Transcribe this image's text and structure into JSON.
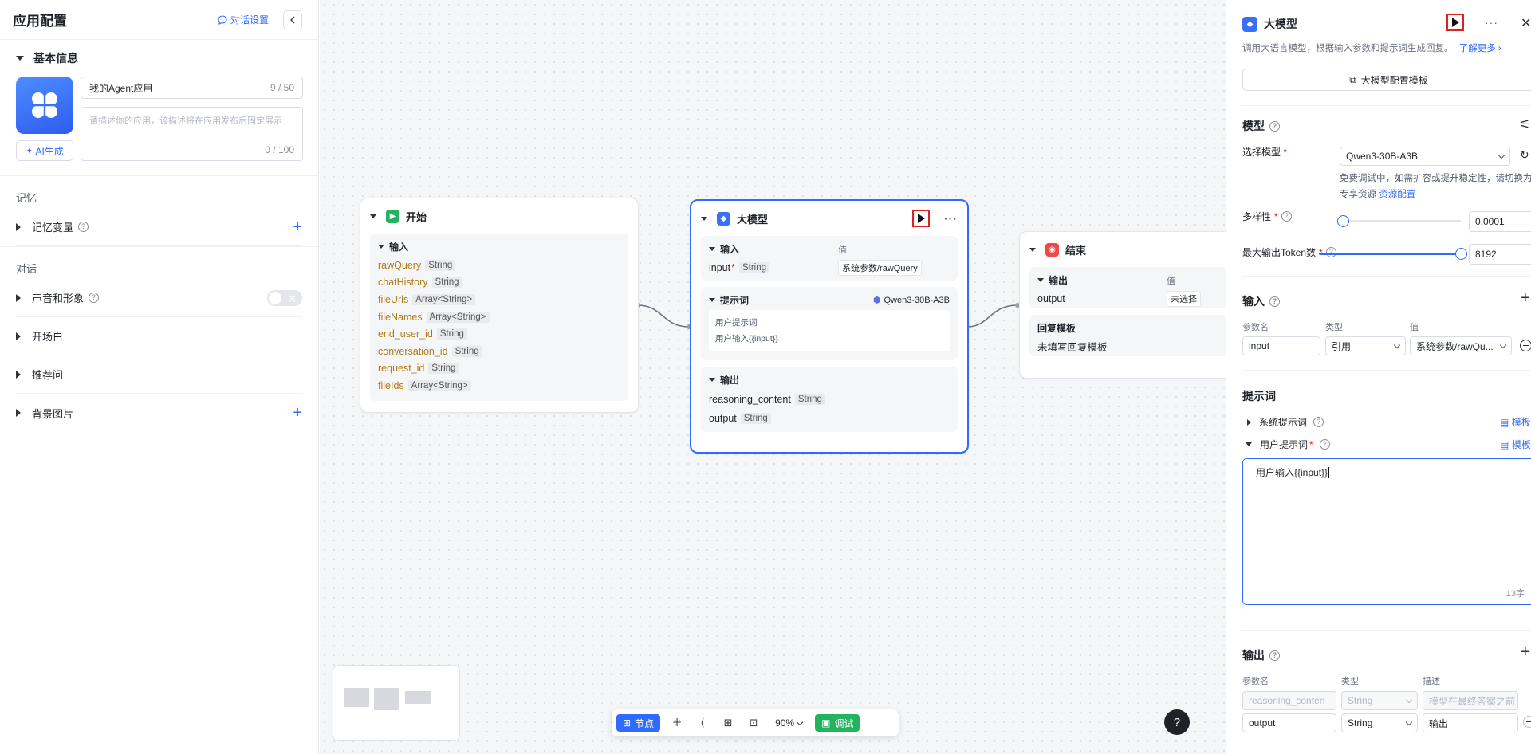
{
  "left": {
    "title": "应用配置",
    "chat_settings": "对话设置",
    "basic_info": "基本信息",
    "app_name": "我的Agent应用",
    "app_name_count": "9 / 50",
    "desc_placeholder": "请描述你的应用，该描述将在应用发布后固定展示",
    "desc_count": "0 / 100",
    "ai_generate": "AI生成",
    "memory_group": "记忆",
    "memory_var": "记忆变量",
    "chat_group": "对话",
    "voice": "声音和形象",
    "toggle_text": "关",
    "opening": "开场白",
    "suggested": "推荐问",
    "bg_image": "背景图片"
  },
  "nodes": {
    "start": {
      "title": "开始",
      "input_label": "输入",
      "vars": [
        {
          "name": "rawQuery",
          "type": "String"
        },
        {
          "name": "chatHistory",
          "type": "String"
        },
        {
          "name": "fileUrls",
          "type": "Array<String>"
        },
        {
          "name": "fileNames",
          "type": "Array<String>"
        },
        {
          "name": "end_user_id",
          "type": "String"
        },
        {
          "name": "conversation_id",
          "type": "String"
        },
        {
          "name": "request_id",
          "type": "String"
        },
        {
          "name": "fileIds",
          "type": "Array<String>"
        }
      ]
    },
    "llm": {
      "title": "大模型",
      "input_label": "输入",
      "value_label": "值",
      "input_name": "input",
      "input_type": "String",
      "input_value": "系统参数/rawQuery",
      "prompt_label": "提示词",
      "model_name": "Qwen3-30B-A3B",
      "user_prompt_label": "用户提示词",
      "user_prompt_text": "用户输入{{input}}",
      "output_label": "输出",
      "outputs": [
        {
          "name": "reasoning_content",
          "type": "String"
        },
        {
          "name": "output",
          "type": "String"
        }
      ]
    },
    "end": {
      "title": "结束",
      "output_label": "输出",
      "value_label": "值",
      "output_name": "output",
      "output_value": "未选择",
      "reply_label": "回复模板",
      "reply_empty": "未填写回复模板"
    }
  },
  "toolbar": {
    "node": "节点",
    "zoom": "90%",
    "debug": "调试"
  },
  "help": "?",
  "right": {
    "title": "大模型",
    "description": "调用大语言模型，根据输入参数和提示词生成回复。",
    "learn_more": "了解更多",
    "config_template": "大模型配置模板",
    "model_section": "模型",
    "select_model_label": "选择模型",
    "selected_model": "Qwen3-30B-A3B",
    "model_note_1": "免费调试中，如需扩容或提升稳定性，请切换为",
    "model_note_2": "专享资源",
    "resource_link": "资源配置",
    "diversity_label": "多样性",
    "diversity_value": "0.0001",
    "diversity_fraction": 0.0,
    "max_tokens_label": "最大输出Token数",
    "max_tokens_value": "8192",
    "max_tokens_fraction": 1.0,
    "input_section": "输入",
    "param_name_hdr": "参数名",
    "type_hdr": "类型",
    "value_hdr": "值",
    "input_param": "input",
    "input_kind": "引用",
    "input_ref": "系统参数/rawQu...",
    "prompt_section": "提示词",
    "system_prompt": "系统提示词",
    "user_prompt": "用户提示词",
    "template_btn": "模板",
    "prompt_text": "用户输入{{input}}",
    "char_count": "13字",
    "output_section": "输出",
    "desc_hdr": "描述",
    "out_row1_name": "reasoning_conten",
    "out_row1_type": "String",
    "out_row1_desc": "模型在最终答案之前",
    "out_row2_name": "output",
    "out_row2_type": "String",
    "out_row2_desc": "输出"
  },
  "colors": {
    "accent": "#2f6bff",
    "run_highlight": "#e02020",
    "start_icon": "#22b35e",
    "end_icon": "#f04848",
    "debug": "#22b35e"
  }
}
